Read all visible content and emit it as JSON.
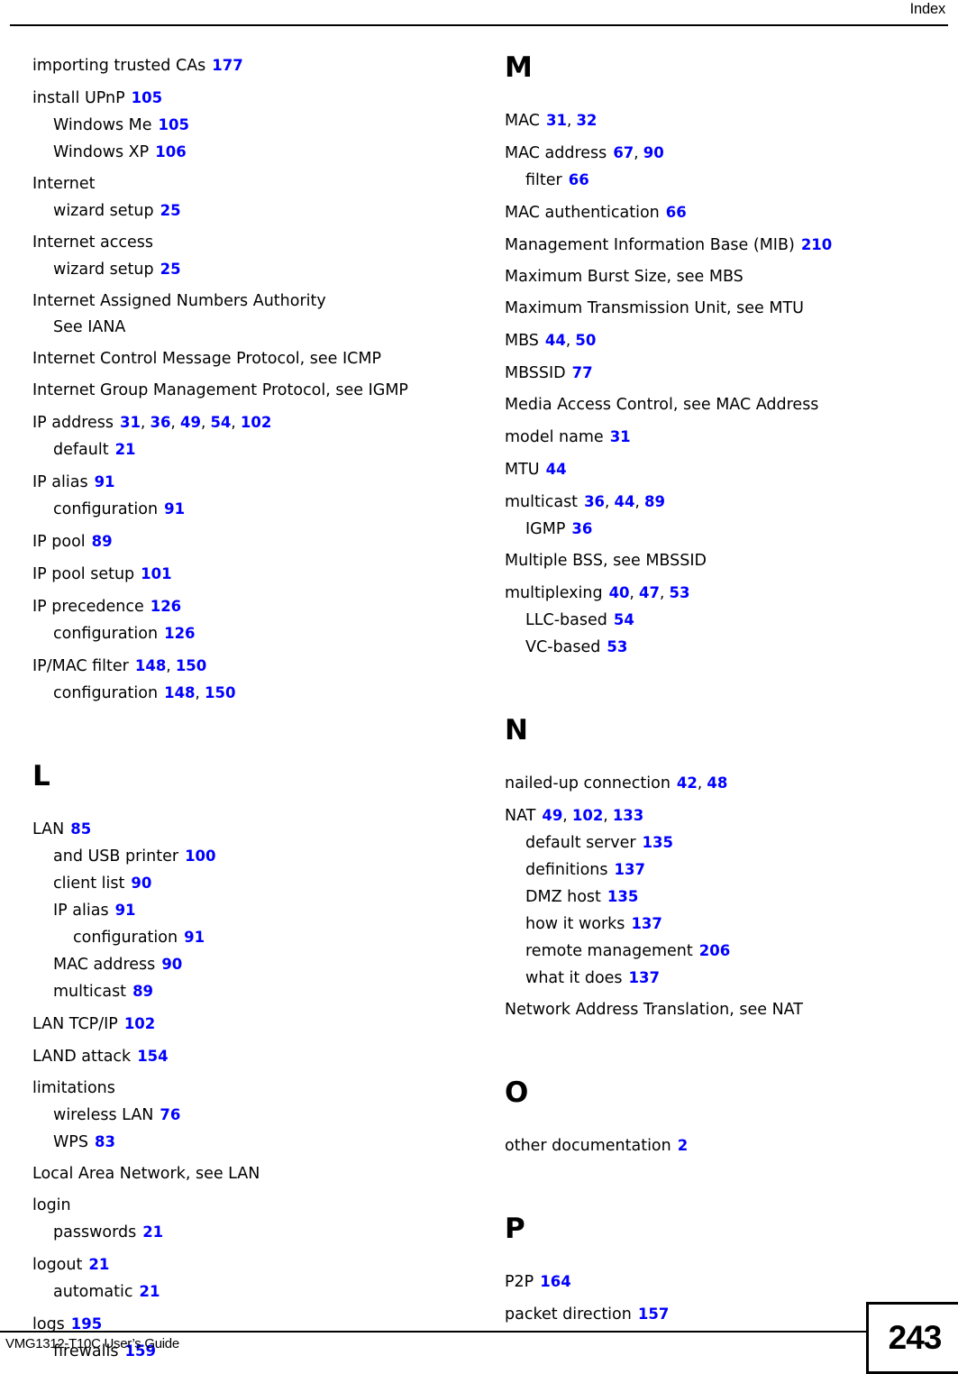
{
  "header": {
    "title": "Index"
  },
  "footer": {
    "guide": "VMG1312-T10C User’s Guide",
    "page_number": "243"
  },
  "colors": {
    "page_reference": "#0000ff",
    "text": "#000000",
    "background": "#ffffff"
  },
  "left_column": {
    "entries": [
      {
        "level": 0,
        "text": "importing trusted CAs",
        "pages": [
          "177"
        ]
      },
      {
        "level": 0,
        "text": "install UPnP",
        "pages": [
          "105"
        ]
      },
      {
        "level": 1,
        "text": "Windows Me",
        "pages": [
          "105"
        ]
      },
      {
        "level": 1,
        "text": "Windows XP",
        "pages": [
          "106"
        ]
      },
      {
        "level": 0,
        "text": "Internet",
        "pages": []
      },
      {
        "level": 1,
        "text": "wizard setup",
        "pages": [
          "25"
        ]
      },
      {
        "level": 0,
        "text": "Internet access",
        "pages": []
      },
      {
        "level": 1,
        "text": "wizard setup",
        "pages": [
          "25"
        ]
      },
      {
        "level": 0,
        "text": "Internet Assigned Numbers Authority",
        "pages": []
      },
      {
        "level": 1,
        "text": "See IANA",
        "pages": []
      },
      {
        "level": 0,
        "text": "Internet Control Message Protocol, see ICMP",
        "pages": []
      },
      {
        "level": 0,
        "text": "Internet Group Management Protocol, see IGMP",
        "pages": []
      },
      {
        "level": 0,
        "text": "IP address",
        "pages": [
          "31",
          "36",
          "49",
          "54",
          "102"
        ]
      },
      {
        "level": 1,
        "text": "default",
        "pages": [
          "21"
        ]
      },
      {
        "level": 0,
        "text": "IP alias",
        "pages": [
          "91"
        ]
      },
      {
        "level": 1,
        "text": "configuration",
        "pages": [
          "91"
        ]
      },
      {
        "level": 0,
        "text": "IP pool",
        "pages": [
          "89"
        ]
      },
      {
        "level": 0,
        "text": "IP pool setup",
        "pages": [
          "101"
        ]
      },
      {
        "level": 0,
        "text": "IP precedence",
        "pages": [
          "126"
        ]
      },
      {
        "level": 1,
        "text": "configuration",
        "pages": [
          "126"
        ]
      },
      {
        "level": 0,
        "text": "IP/MAC filter",
        "pages": [
          "148",
          "150"
        ]
      },
      {
        "level": 1,
        "text": "configuration",
        "pages": [
          "148",
          "150"
        ]
      }
    ],
    "section_letter": "L",
    "section_entries": [
      {
        "level": 0,
        "text": "LAN",
        "pages": [
          "85"
        ]
      },
      {
        "level": 1,
        "text": "and USB printer",
        "pages": [
          "100"
        ]
      },
      {
        "level": 1,
        "text": "client list",
        "pages": [
          "90"
        ]
      },
      {
        "level": 1,
        "text": "IP alias",
        "pages": [
          "91"
        ]
      },
      {
        "level": 2,
        "text": "configuration",
        "pages": [
          "91"
        ]
      },
      {
        "level": 1,
        "text": "MAC address",
        "pages": [
          "90"
        ]
      },
      {
        "level": 1,
        "text": "multicast",
        "pages": [
          "89"
        ]
      },
      {
        "level": 0,
        "text": "LAN TCP/IP",
        "pages": [
          "102"
        ]
      },
      {
        "level": 0,
        "text": "LAND attack",
        "pages": [
          "154"
        ]
      },
      {
        "level": 0,
        "text": "limitations",
        "pages": []
      },
      {
        "level": 1,
        "text": "wireless LAN",
        "pages": [
          "76"
        ]
      },
      {
        "level": 1,
        "text": "WPS",
        "pages": [
          "83"
        ]
      },
      {
        "level": 0,
        "text": "Local Area Network, see LAN",
        "pages": []
      },
      {
        "level": 0,
        "text": "login",
        "pages": []
      },
      {
        "level": 1,
        "text": "passwords",
        "pages": [
          "21"
        ]
      },
      {
        "level": 0,
        "text": "logout",
        "pages": [
          "21"
        ]
      },
      {
        "level": 1,
        "text": "automatic",
        "pages": [
          "21"
        ]
      },
      {
        "level": 0,
        "text": "logs",
        "pages": [
          "195"
        ]
      },
      {
        "level": 1,
        "text": "firewalls",
        "pages": [
          "159"
        ]
      }
    ]
  },
  "right_column": {
    "sections": [
      {
        "letter": "M",
        "entries": [
          {
            "level": 0,
            "text": "MAC",
            "pages": [
              "31",
              "32"
            ]
          },
          {
            "level": 0,
            "text": "MAC address",
            "pages": [
              "67",
              "90"
            ]
          },
          {
            "level": 1,
            "text": "filter",
            "pages": [
              "66"
            ]
          },
          {
            "level": 0,
            "text": "MAC authentication",
            "pages": [
              "66"
            ]
          },
          {
            "level": 0,
            "text": "Management Information Base (MIB)",
            "pages": [
              "210"
            ]
          },
          {
            "level": 0,
            "text": "Maximum Burst Size, see MBS",
            "pages": []
          },
          {
            "level": 0,
            "text": "Maximum Transmission Unit, see MTU",
            "pages": []
          },
          {
            "level": 0,
            "text": "MBS",
            "pages": [
              "44",
              "50"
            ]
          },
          {
            "level": 0,
            "text": "MBSSID",
            "pages": [
              "77"
            ]
          },
          {
            "level": 0,
            "text": "Media Access Control, see MAC Address",
            "pages": []
          },
          {
            "level": 0,
            "text": "model name",
            "pages": [
              "31"
            ]
          },
          {
            "level": 0,
            "text": "MTU",
            "pages": [
              "44"
            ]
          },
          {
            "level": 0,
            "text": "multicast",
            "pages": [
              "36",
              "44",
              "89"
            ]
          },
          {
            "level": 1,
            "text": "IGMP",
            "pages": [
              "36"
            ]
          },
          {
            "level": 0,
            "text": "Multiple BSS, see MBSSID",
            "pages": []
          },
          {
            "level": 0,
            "text": "multiplexing",
            "pages": [
              "40",
              "47",
              "53"
            ]
          },
          {
            "level": 1,
            "text": "LLC-based",
            "pages": [
              "54"
            ]
          },
          {
            "level": 1,
            "text": "VC-based",
            "pages": [
              "53"
            ]
          }
        ]
      },
      {
        "letter": "N",
        "entries": [
          {
            "level": 0,
            "text": "nailed-up connection",
            "pages": [
              "42",
              "48"
            ]
          },
          {
            "level": 0,
            "text": "NAT",
            "pages": [
              "49",
              "102",
              "133"
            ]
          },
          {
            "level": 1,
            "text": "default server",
            "pages": [
              "135"
            ]
          },
          {
            "level": 1,
            "text": "definitions",
            "pages": [
              "137"
            ]
          },
          {
            "level": 1,
            "text": "DMZ host",
            "pages": [
              "135"
            ]
          },
          {
            "level": 1,
            "text": "how it works",
            "pages": [
              "137"
            ]
          },
          {
            "level": 1,
            "text": "remote management",
            "pages": [
              "206"
            ]
          },
          {
            "level": 1,
            "text": "what it does",
            "pages": [
              "137"
            ]
          },
          {
            "level": 0,
            "text": "Network Address Translation, see NAT",
            "pages": []
          }
        ]
      },
      {
        "letter": "O",
        "entries": [
          {
            "level": 0,
            "text": "other documentation",
            "pages": [
              "2"
            ]
          }
        ]
      },
      {
        "letter": "P",
        "entries": [
          {
            "level": 0,
            "text": "P2P",
            "pages": [
              "164"
            ]
          },
          {
            "level": 0,
            "text": "packet direction",
            "pages": [
              "157"
            ]
          }
        ]
      }
    ]
  }
}
